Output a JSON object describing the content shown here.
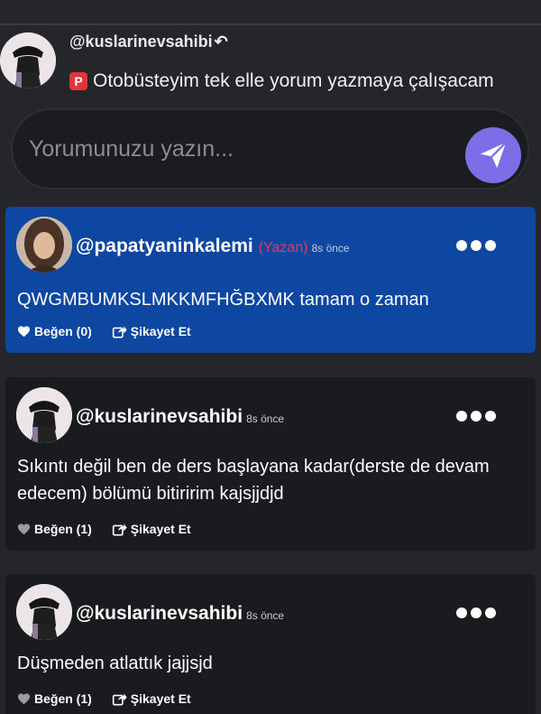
{
  "reply_context": {
    "username": "@kuslarinevsahibi",
    "reply_icon": "reply-arrow-icon",
    "badge_letter": "P",
    "text": "Otobüsteyim tek elle yorum yazmaya çalışacam"
  },
  "comment_box": {
    "placeholder": "Yorumunuzu yazın...",
    "send_icon": "send-icon",
    "accent": "#7c6ee6"
  },
  "comments": [
    {
      "username": "@papatyaninkalemi",
      "author_tag": "(Yazan)",
      "time": "8s önce",
      "text": "QWGMBUMKSLMKKMFHĞBXMK tamam o zaman",
      "like_label": "Beğen (0)",
      "report_label": "Şikayet Et",
      "highlight_color": "#0d47a1"
    },
    {
      "username": "@kuslarinevsahibi",
      "time": "8s önce",
      "text": "Sıkıntı değil ben de ders başlayana kadar(derste de devam edecem) bölümü bitiririm kajsjjdjd",
      "like_label": "Beğen (1)",
      "report_label": "Şikayet Et"
    },
    {
      "username": "@kuslarinevsahibi",
      "time": "8s önce",
      "text": "Düşmeden atlattık jajjsjd",
      "like_label": "Beğen (1)",
      "report_label": "Şikayet Et"
    }
  ],
  "colors": {
    "background": "#25262a",
    "card": "#1a1b1e",
    "author_tag": "#e23a5d",
    "badge": "#e2353a"
  }
}
